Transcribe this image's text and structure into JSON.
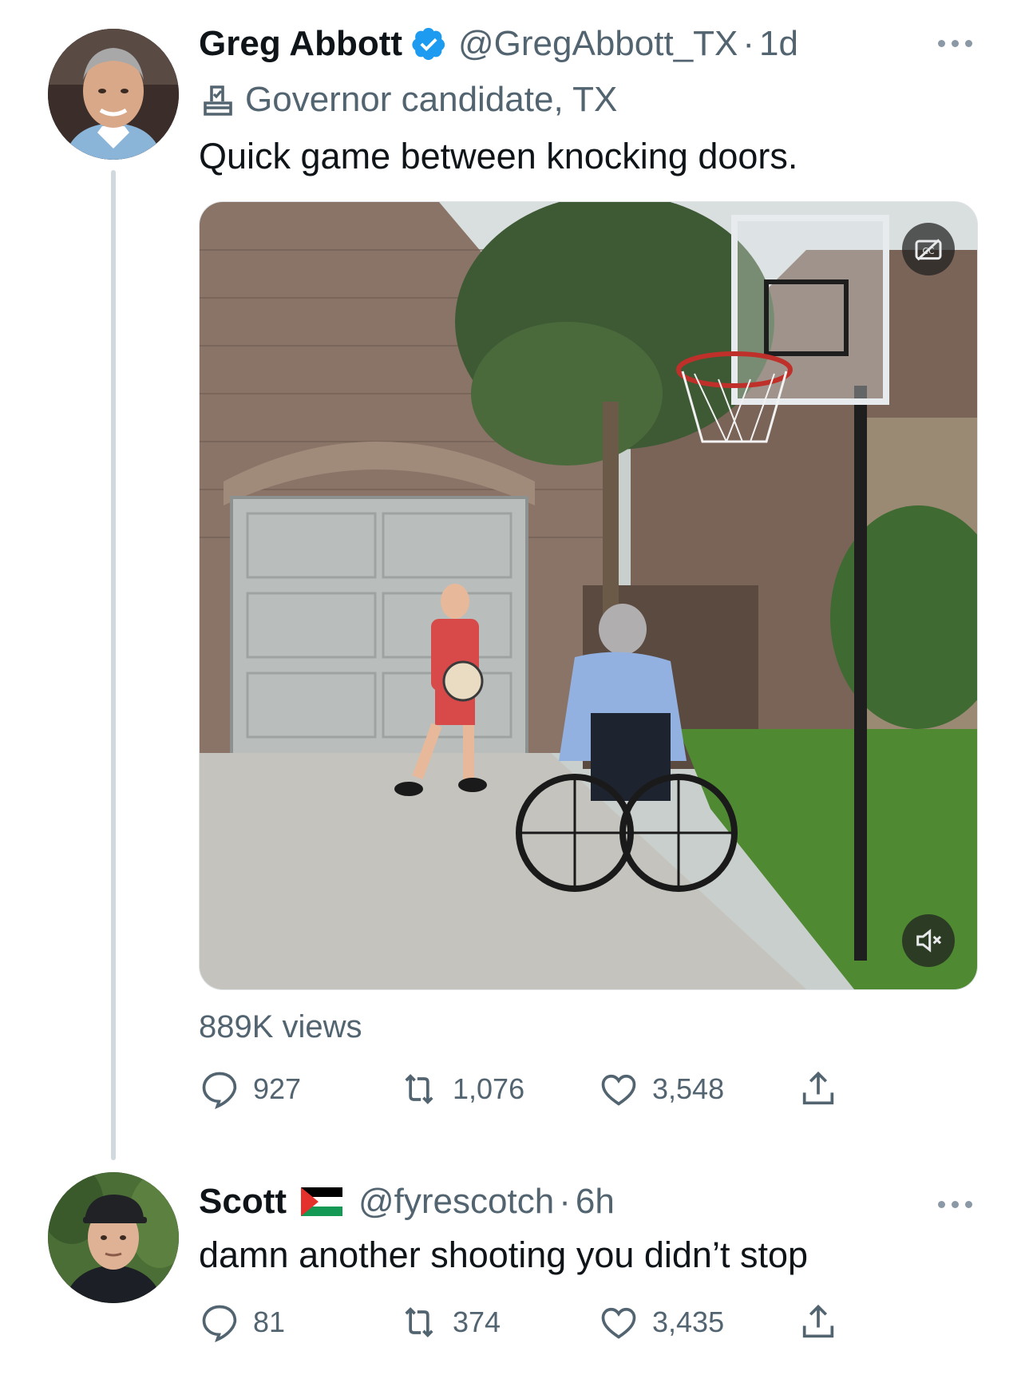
{
  "tweet1": {
    "display_name": "Greg Abbott",
    "handle": "@GregAbbott_TX",
    "separator": "·",
    "time": "1d",
    "label": "Governor candidate, TX",
    "text": "Quick game between knocking doors.",
    "views": "889K views",
    "replies": "927",
    "retweets": "1,076",
    "likes": "3,548"
  },
  "tweet2": {
    "display_name": "Scott",
    "handle": "@fyrescotch",
    "separator": "·",
    "time": "6h",
    "text": "damn another shooting you didn’t stop",
    "replies": "81",
    "retweets": "374",
    "likes": "3,435"
  },
  "colors": {
    "verified_blue": "#1d9bf0",
    "secondary_text": "#536471",
    "thread_line": "#cfd9de"
  },
  "icons": [
    "verified-badge-icon",
    "ballot-box-icon",
    "more-icon",
    "reply-icon",
    "retweet-icon",
    "like-icon",
    "share-icon",
    "captions-off-icon",
    "muted-icon",
    "palestine-flag-icon"
  ]
}
